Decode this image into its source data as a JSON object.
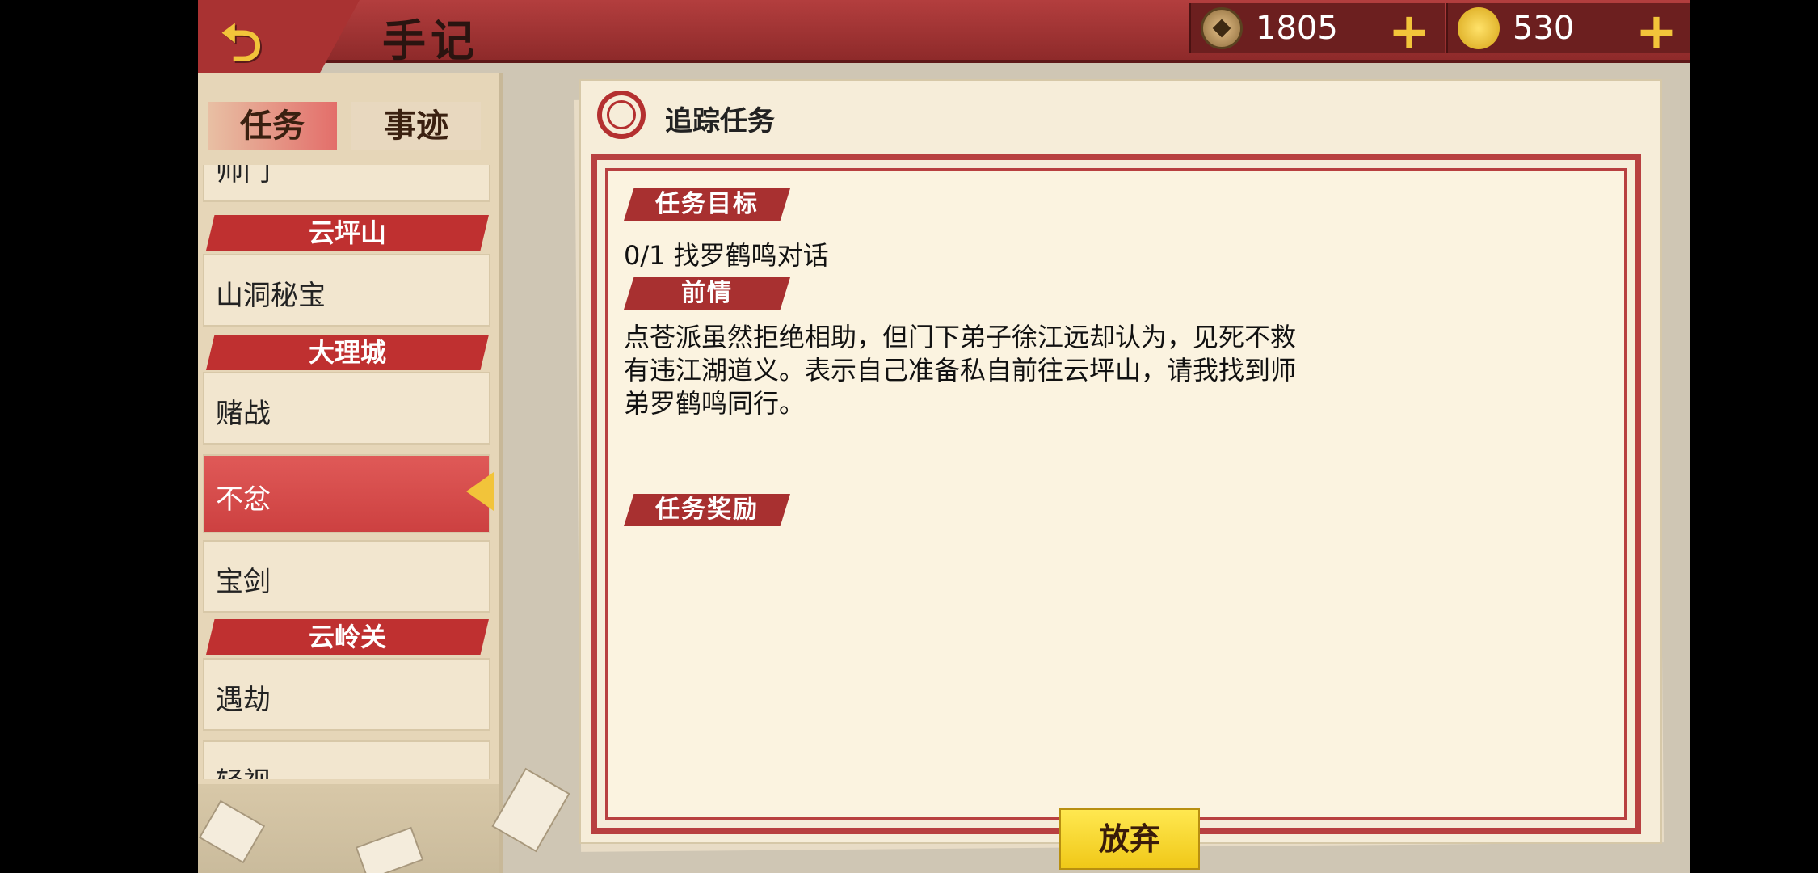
{
  "header": {
    "title": "手记",
    "copper_value": "1805",
    "gold_value": "530",
    "plus": "+"
  },
  "left_panel": {
    "tabs": [
      {
        "label": "任务",
        "active": true
      },
      {
        "label": "事迹",
        "active": false
      }
    ],
    "list_items": [
      {
        "type": "item",
        "label": "帅门"
      },
      {
        "type": "header",
        "label": "云坪山"
      },
      {
        "type": "item",
        "label": "山洞秘宝"
      },
      {
        "type": "header",
        "label": "大理城"
      },
      {
        "type": "item",
        "label": "赌战"
      },
      {
        "type": "item",
        "label": "不忿",
        "selected": true
      },
      {
        "type": "item",
        "label": "宝剑"
      },
      {
        "type": "header",
        "label": "云岭关"
      },
      {
        "type": "item",
        "label": "遇劫"
      },
      {
        "type": "item",
        "label": "轻视"
      }
    ]
  },
  "quest": {
    "tracking_title": "追踪任务",
    "objective_label": "任务目标",
    "objective_text": "0/1 找罗鹤鸣对话",
    "background_label": "前情",
    "background_text": "点苍派虽然拒绝相助，但门下弟子徐江远却认为，见死不救有违江湖道义。表示自己准备私自前往云坪山，请我找到师弟罗鹤鸣同行。",
    "reward_label": "任务奖励",
    "abandon_label": "放弃"
  },
  "colors": {
    "accent_red": "#b33e3e",
    "gold": "#f2c43a",
    "parchment": "#f6edd9"
  },
  "icons": [
    "back-arrow-icon",
    "copper-coin-icon",
    "gold-ingot-icon",
    "plus-icon",
    "tracking-circle-icon",
    "selected-arrow-icon"
  ]
}
